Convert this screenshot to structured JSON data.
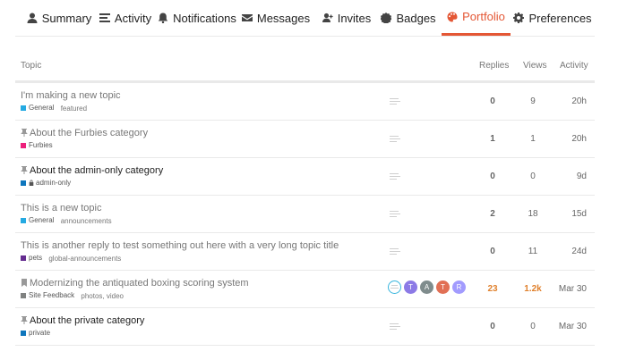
{
  "tabs": [
    {
      "label": "Summary",
      "icon": "user-icon",
      "active": false
    },
    {
      "label": "Activity",
      "icon": "stream-icon",
      "active": false
    },
    {
      "label": "Notifications",
      "icon": "bell-icon",
      "active": false
    },
    {
      "label": "Messages",
      "icon": "envelope-icon",
      "active": false
    },
    {
      "label": "Invites",
      "icon": "user-plus-icon",
      "active": false
    },
    {
      "label": "Badges",
      "icon": "certificate-icon",
      "active": false
    },
    {
      "label": "Portfolio",
      "icon": "palette-icon",
      "active": true
    },
    {
      "label": "Preferences",
      "icon": "cog-icon",
      "active": false
    }
  ],
  "colors": {
    "accent": "#e45735",
    "hot": "#e0812d"
  },
  "table": {
    "headers": {
      "topic": "Topic",
      "replies": "Replies",
      "views": "Views",
      "activity": "Activity"
    },
    "rows": [
      {
        "title": "I'm making a new topic",
        "pinned": false,
        "unread": false,
        "category": {
          "name": "General",
          "color": "#25aae2",
          "locked": false
        },
        "tags": [
          "featured"
        ],
        "posters": [
          "placeholder"
        ],
        "replies": "0",
        "views": "9",
        "activity": "20h"
      },
      {
        "title": "About the Furbies category",
        "pinned": true,
        "unread": false,
        "category": {
          "name": "Furbies",
          "color": "#ed207b",
          "locked": false
        },
        "tags": [],
        "posters": [
          "placeholder"
        ],
        "replies": "1",
        "views": "1",
        "activity": "20h"
      },
      {
        "title": "About the admin-only category",
        "pinned": true,
        "unread": true,
        "category": {
          "name": "admin-only",
          "color": "#0e76bd",
          "locked": true
        },
        "tags": [],
        "posters": [
          "placeholder"
        ],
        "replies": "0",
        "views": "0",
        "activity": "9d"
      },
      {
        "title": "This is a new topic",
        "pinned": false,
        "unread": false,
        "category": {
          "name": "General",
          "color": "#25aae2",
          "locked": false
        },
        "tags": [
          "announcements"
        ],
        "posters": [
          "placeholder"
        ],
        "replies": "2",
        "views": "18",
        "activity": "15d"
      },
      {
        "title": "This is another reply to test something out here with a very long topic title",
        "pinned": false,
        "unread": false,
        "category": {
          "name": "pets",
          "color": "#652d90",
          "locked": false
        },
        "tags": [
          "global-announcements"
        ],
        "posters": [
          "placeholder"
        ],
        "replies": "0",
        "views": "11",
        "activity": "24d"
      },
      {
        "title": "Modernizing the antiquated boxing scoring system",
        "pinned": false,
        "bookmarked": true,
        "unread": false,
        "category": {
          "name": "Site Feedback",
          "color": "#808281",
          "locked": false
        },
        "tags": [
          "photos, video"
        ],
        "posters": [
          {
            "type": "ring"
          },
          {
            "letter": "T",
            "color": "#8c7ae6"
          },
          {
            "letter": "A",
            "color": "#7f8c8d"
          },
          {
            "letter": "T",
            "color": "#e17055"
          },
          {
            "letter": "R",
            "color": "#a29bfe"
          }
        ],
        "replies": "23",
        "views": "1.2k",
        "activity": "Mar 30",
        "hot": true
      },
      {
        "title": "About the private category",
        "pinned": true,
        "unread": true,
        "category": {
          "name": "private",
          "color": "#0e76bd",
          "locked": false
        },
        "tags": [],
        "posters": [
          "placeholder"
        ],
        "replies": "0",
        "views": "0",
        "activity": "Mar 30"
      }
    ]
  }
}
